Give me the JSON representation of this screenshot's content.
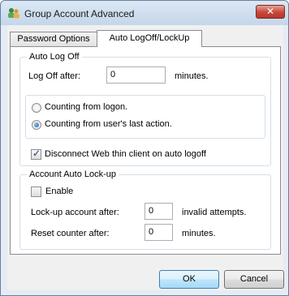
{
  "window": {
    "title": "Group Account Advanced",
    "close_glyph": "✕"
  },
  "tabs": [
    {
      "label": "Password Options",
      "active": false
    },
    {
      "label": "Auto LogOff/LockUp",
      "active": true
    }
  ],
  "auto_log_off": {
    "group_label": "Auto Log Off",
    "log_off_label": "Log Off after:",
    "log_off_value": "0",
    "minutes_label": "minutes.",
    "radio_logon": "Counting from logon.",
    "radio_last_action": "Counting from user's last action.",
    "selected_radio": "last_action",
    "disconnect_label": "Disconnect Web thin client on auto logoff",
    "disconnect_checked": true
  },
  "lockup": {
    "group_label": "Account Auto Lock-up",
    "enable_label": "Enable",
    "enable_checked": false,
    "lockup_label": "Lock-up account after:",
    "lockup_value": "0",
    "invalid_label": "invalid attempts.",
    "reset_label": "Reset counter after:",
    "reset_value": "0",
    "minutes_label": "minutes."
  },
  "buttons": {
    "ok": "OK",
    "cancel": "Cancel"
  },
  "icons": {
    "app": "group-users-icon",
    "close": "close-icon"
  }
}
